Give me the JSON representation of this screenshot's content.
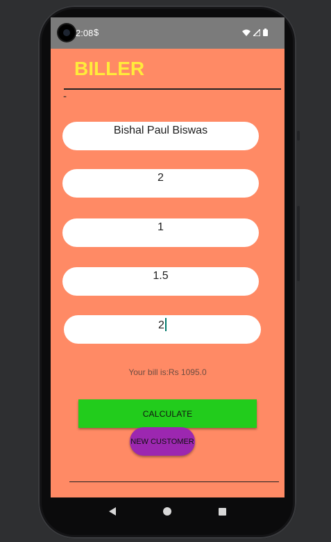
{
  "status_bar": {
    "time": "2:08",
    "extra_icon": "$"
  },
  "app": {
    "title": "BILLER",
    "dash": "-"
  },
  "fields": [
    {
      "value": "Bishal Paul Biswas"
    },
    {
      "value": "2"
    },
    {
      "value": "1"
    },
    {
      "value": "1.5"
    },
    {
      "value": "2",
      "focused": true
    }
  ],
  "result": {
    "text": "Your bill is:Rs 1095.0"
  },
  "buttons": {
    "calculate": "CALCULATE",
    "new_customer": "NEW CUSTOMER"
  },
  "colors": {
    "screen_background": "#ff8a65",
    "title": "#ffeb3b",
    "calculate_button": "#22cc1c",
    "new_customer_button": "#9c27b0"
  }
}
